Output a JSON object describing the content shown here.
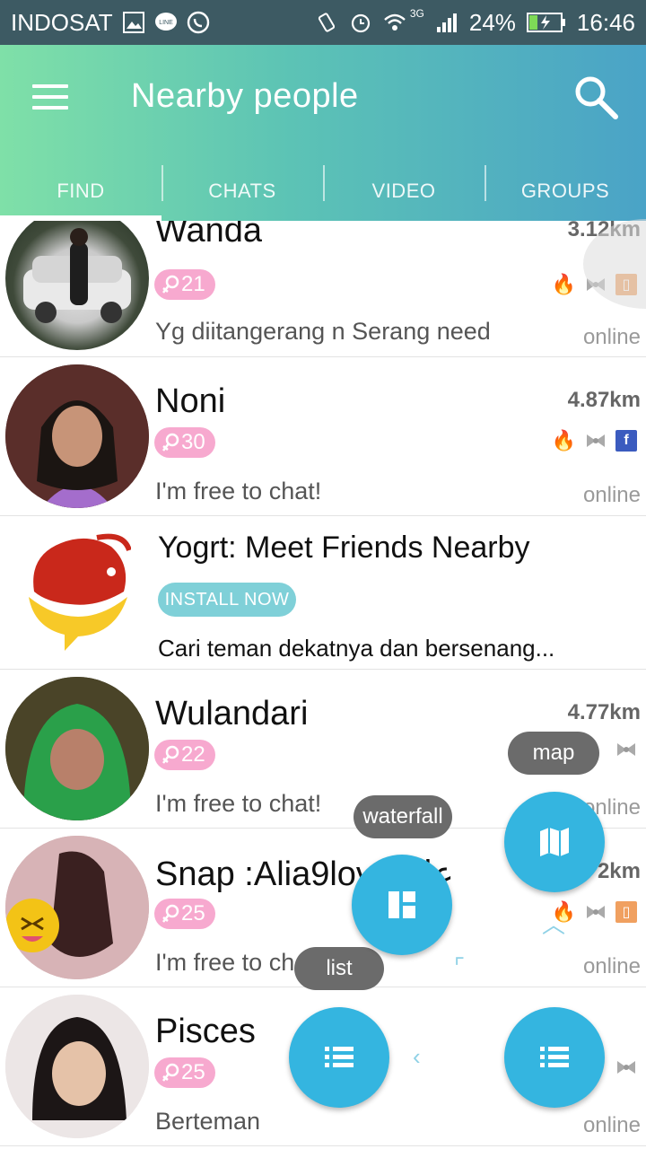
{
  "status_bar": {
    "carrier": "INDOSAT",
    "network": "3G",
    "battery": "24%",
    "time": "16:46"
  },
  "app_bar": {
    "title": "Nearby people",
    "tabs": [
      "FIND",
      "CHATS",
      "VIDEO",
      "GROUPS"
    ],
    "active_tab": "FIND"
  },
  "people": [
    {
      "name": "Wanda",
      "age": "21",
      "distance": "3.12km",
      "status": "Yg diitangerang n Serang need",
      "presence": "online"
    },
    {
      "name": "Noni",
      "age": "30",
      "distance": "4.87km",
      "status": "I'm free to chat!",
      "presence": "online"
    },
    {
      "name": "Wulandari",
      "age": "22",
      "distance": "4.77km",
      "status": "I'm free to chat!",
      "presence": "online"
    },
    {
      "name": "Snap :Alia9love عليا",
      "age": "25",
      "distance": "2km",
      "status": "I'm free to chat!",
      "presence": "online"
    },
    {
      "name": "Pisces",
      "age": "25",
      "distance": "",
      "status": "Berteman",
      "presence": "online"
    }
  ],
  "ad": {
    "title": "Yogrt: Meet Friends Nearby",
    "button": "INSTALL NOW",
    "description": "Cari teman dekatnya dan bersenang..."
  },
  "fab_menu": {
    "map_label": "map",
    "waterfall_label": "waterfall",
    "list_label": "list"
  },
  "colors": {
    "appbar_start": "#7fe0a8",
    "appbar_end": "#4aa3c7",
    "fab": "#34b5e0",
    "age_badge": "#f7a9cf"
  }
}
